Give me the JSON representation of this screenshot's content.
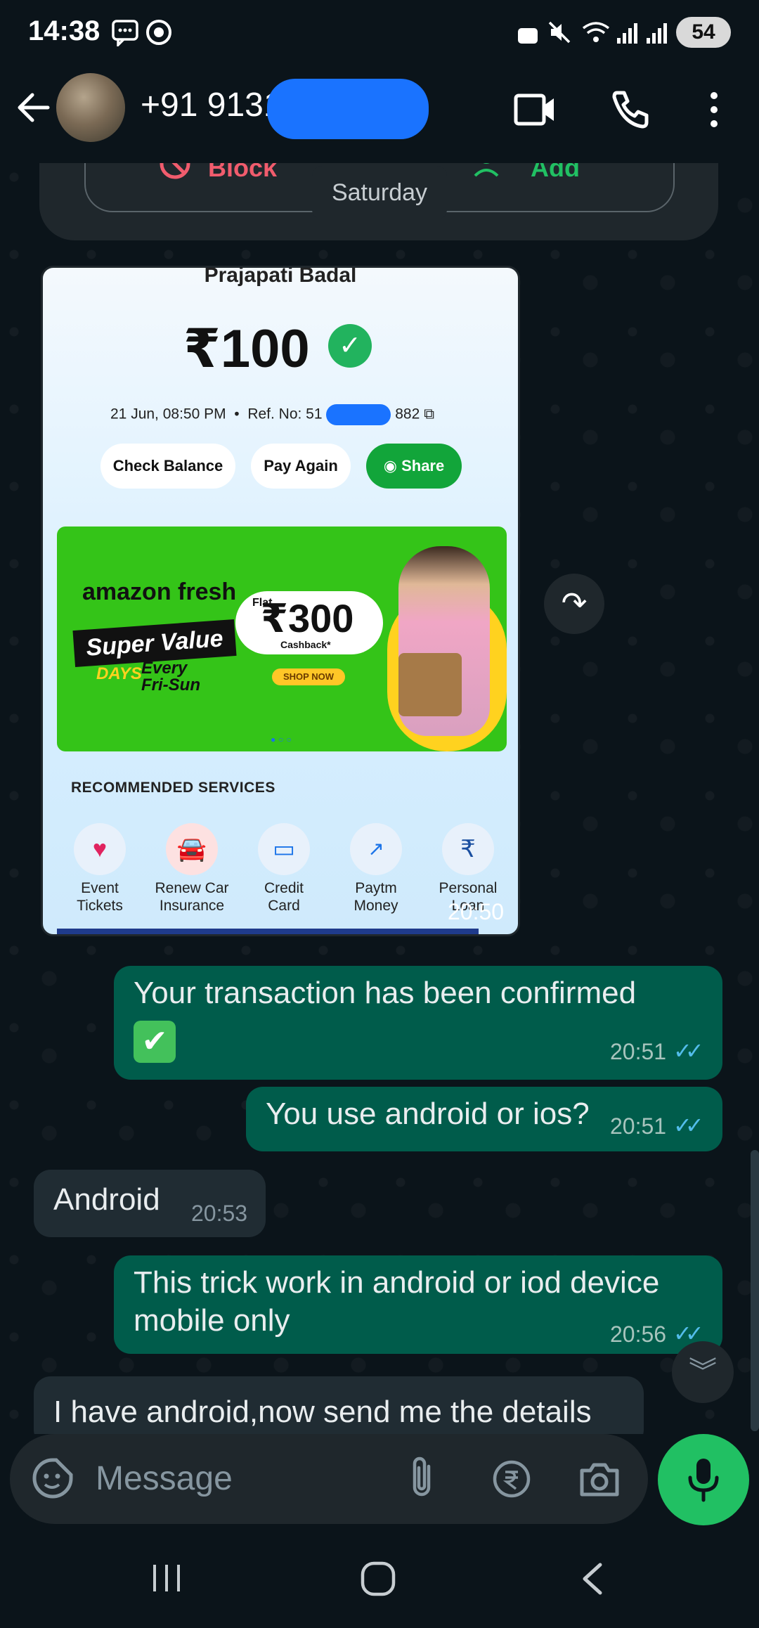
{
  "status_bar": {
    "time": "14:38",
    "battery": "54"
  },
  "header": {
    "contact": "+91 9131",
    "icons": [
      "back-arrow-icon",
      "video-call-icon",
      "voice-call-icon",
      "more-vert-icon"
    ]
  },
  "info_card": {
    "block_label": "Block",
    "add_label": "Add"
  },
  "date_chip": "Saturday",
  "payment_image": {
    "payee": "Prajapati Badal",
    "amount": "₹100",
    "date": "21 Jun, 08:50 PM",
    "ref_prefix": "Ref. No: 51",
    "ref_suffix": "882",
    "buttons": [
      "Check Balance",
      "Pay Again",
      "Share"
    ],
    "banner": {
      "brand": "amazon fresh",
      "tagline": "Super Value",
      "days": "DAYS",
      "every": "Every",
      "fri_sun": "Fri-Sun",
      "flat": "Flat",
      "offer": "₹300",
      "cashback": "Cashback*",
      "cta": "SHOP NOW"
    },
    "recommended_title": "RECOMMENDED SERVICES",
    "services": [
      {
        "line1": "Event",
        "line2": "Tickets"
      },
      {
        "line1": "Renew Car",
        "line2": "Insurance"
      },
      {
        "line1": "Credit",
        "line2": "Card"
      },
      {
        "line1": "Paytm",
        "line2": "Money"
      },
      {
        "line1": "Personal",
        "line2": "Loan"
      }
    ],
    "time": "20:50"
  },
  "messages": [
    {
      "dir": "out",
      "text": "Your transaction has been confirmed",
      "emoji": "✔",
      "time": "20:51"
    },
    {
      "dir": "out",
      "text": "You use android or ios?",
      "time": "20:51"
    },
    {
      "dir": "in",
      "text": "Android",
      "time": "20:53"
    },
    {
      "dir": "out",
      "text": "This trick work in android or iod device mobile only",
      "time": "20:56"
    },
    {
      "dir": "in",
      "text": "I have android,now send me the details"
    }
  ],
  "composer": {
    "placeholder": "Message"
  },
  "colors": {
    "background": "#0b141a",
    "outgoing_bubble": "#005c4b",
    "incoming_bubble": "#202c33",
    "accent_green": "#21c063",
    "read_ticks": "#53bdeb"
  }
}
